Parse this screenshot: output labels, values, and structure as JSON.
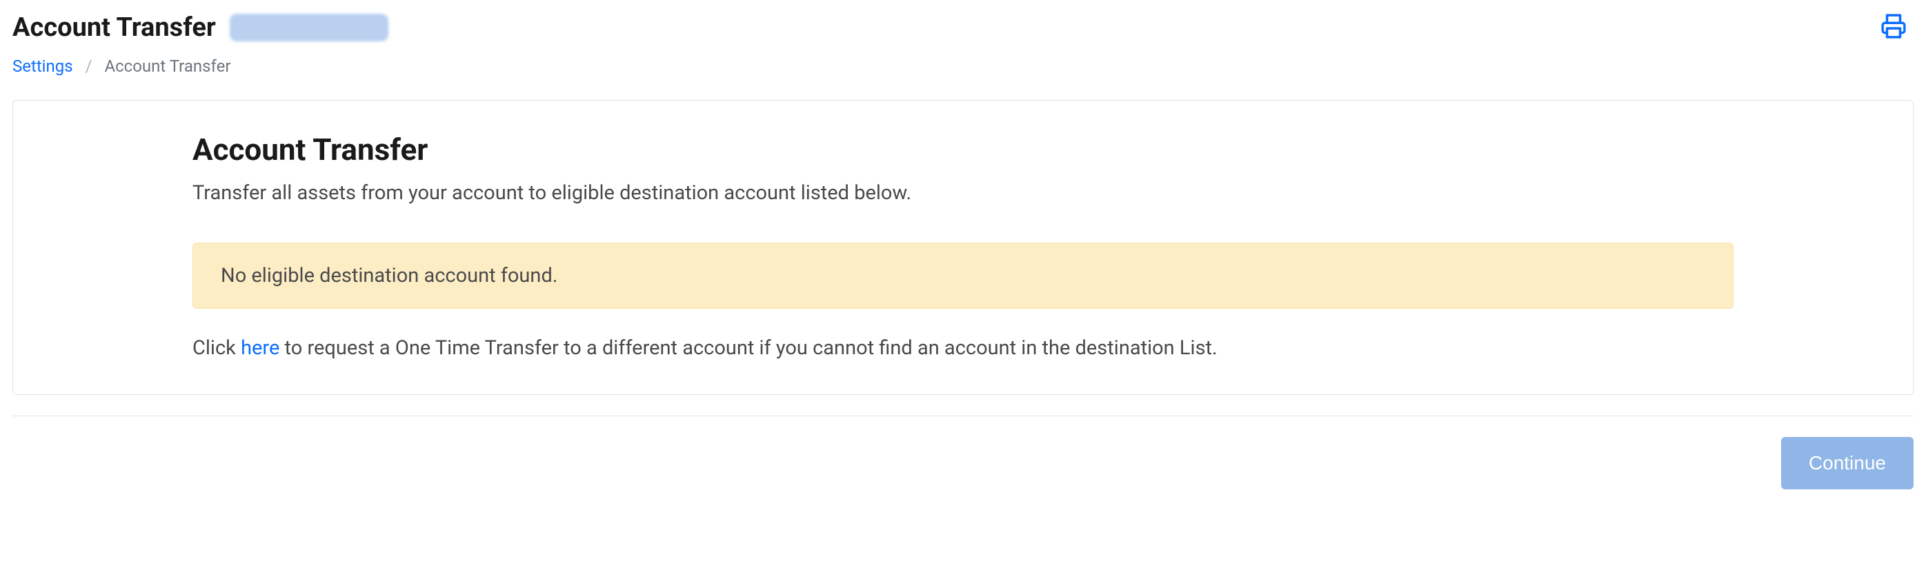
{
  "header": {
    "title": "Account Transfer"
  },
  "breadcrumb": {
    "parent": "Settings",
    "current": "Account Transfer"
  },
  "card": {
    "title": "Account Transfer",
    "subtitle": "Transfer all assets from your account to eligible destination account listed below.",
    "alert": "No eligible destination account found.",
    "help_prefix": "Click ",
    "help_link": "here",
    "help_suffix": " to request a One Time Transfer to a different account if you cannot find an account in the destination List."
  },
  "actions": {
    "continue": "Continue"
  }
}
